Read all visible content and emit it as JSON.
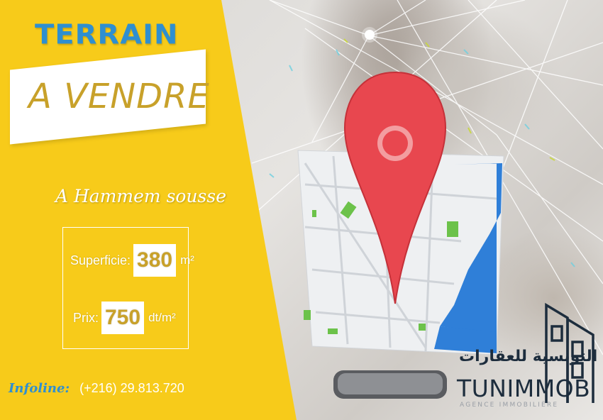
{
  "headline": {
    "line1": "TERRAIN",
    "line2": "A VENDRE"
  },
  "location": "A Hammem sousse",
  "details": {
    "area_label": "Superficie:",
    "area_value": "380",
    "area_unit": "m²",
    "price_label": "Prix:",
    "price_value": "750",
    "price_unit": "dt/m²"
  },
  "contact": {
    "label": "Infoline:",
    "phone": "(+216) 29.813.720"
  },
  "brand": {
    "arabic_name": "التونسية للعقارات",
    "name": "TUNIMMOB",
    "subtitle": "AGENCE IMMOBILIÈRE"
  },
  "colors": {
    "yellow": "#f7cb1a",
    "accent_blue": "#2f8fd0",
    "gold_text": "#c8a12a",
    "pin_red": "#e8474f",
    "map_water": "#2f7fd8",
    "map_green": "#6cc24a",
    "logo_dark": "#1d2d3d"
  },
  "icons": [
    "location-pin-icon",
    "map-icon",
    "building-logo-icon",
    "smartphone-icon"
  ]
}
